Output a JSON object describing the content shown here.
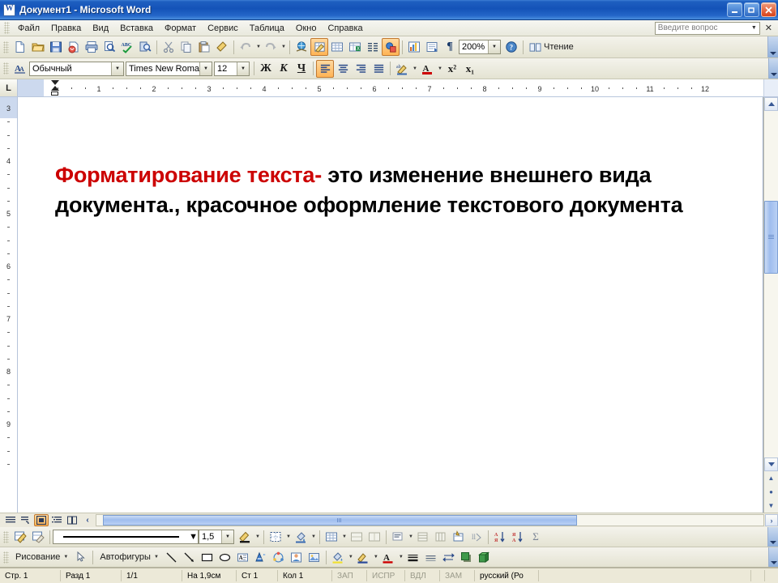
{
  "window": {
    "title": "Документ1 - Microsoft Word",
    "icon": "word-document-icon",
    "minimize": "_",
    "restore": "❐",
    "close": "✕",
    "titlebar_color": "#1453b8"
  },
  "menu": {
    "items": [
      {
        "label": "Файл"
      },
      {
        "label": "Правка"
      },
      {
        "label": "Вид"
      },
      {
        "label": "Вставка"
      },
      {
        "label": "Формат"
      },
      {
        "label": "Сервис"
      },
      {
        "label": "Таблица"
      },
      {
        "label": "Окно"
      },
      {
        "label": "Справка"
      }
    ],
    "ask_box": {
      "placeholder": "Введите вопрос",
      "value": "Введите вопрос"
    },
    "close_label": "✕"
  },
  "standard_toolbar": {
    "buttons": [
      {
        "name": "new-document-icon"
      },
      {
        "name": "open-folder-icon"
      },
      {
        "name": "save-icon"
      },
      {
        "name": "email-icon"
      },
      {
        "name": "print-icon"
      },
      {
        "name": "quick-print-icon"
      },
      {
        "name": "spelling-check-icon"
      },
      {
        "name": "research-icon"
      },
      {
        "name": "cut-scissors-icon"
      },
      {
        "name": "copy-icon"
      },
      {
        "name": "paste-icon"
      },
      {
        "name": "format-painter-icon"
      },
      {
        "name": "undo-icon"
      },
      {
        "name": "redo-icon"
      },
      {
        "name": "insert-hyperlink-icon"
      },
      {
        "name": "tables-and-borders-icon"
      },
      {
        "name": "insert-table-icon"
      },
      {
        "name": "insert-excel-sheet-icon"
      },
      {
        "name": "columns-icon"
      },
      {
        "name": "drawing-icon"
      },
      {
        "name": "document-map-icon"
      },
      {
        "name": "show-hide-paragraph-icon"
      },
      {
        "name": "pilcrow-icon"
      },
      {
        "name": "help-icon"
      }
    ],
    "zoom": {
      "value": "200%"
    },
    "reading_label": "Чтение",
    "pilcrow": "¶"
  },
  "formatting_toolbar": {
    "styles_icon": "styles-and-formatting-icon",
    "style": {
      "value": "Обычный"
    },
    "font": {
      "value": "Times New Roman"
    },
    "size": {
      "value": "12"
    },
    "bold": "Ж",
    "italic": "К",
    "underline": "Ч",
    "align_left": "align-left-icon",
    "align_center": "align-center-icon",
    "align_right": "align-right-icon",
    "align_justify": "align-justify-icon",
    "highlight": "highlight-icon",
    "font_color": "font-color-icon",
    "superscript": "x²",
    "subscript": "x₁"
  },
  "ruler": {
    "tab_selector": "L",
    "horizontal_ticks": [
      "1",
      "2",
      "3",
      "4",
      "5",
      "6",
      "7",
      "8",
      "9",
      "10",
      "11",
      "12"
    ],
    "vertical_ticks": [
      "3",
      "4",
      "5",
      "6",
      "7",
      "8",
      "9"
    ]
  },
  "document": {
    "red_text": "Форматирование текста-",
    "rest_text": " это изменение внешнего вида документа., красочное оформление текстового документа",
    "red_color": "#cc0000"
  },
  "view_bar": {
    "buttons": [
      {
        "name": "normal-view-icon"
      },
      {
        "name": "web-layout-view-icon"
      },
      {
        "name": "print-layout-view-icon",
        "selected": true
      },
      {
        "name": "outline-view-icon"
      },
      {
        "name": "reading-layout-view-icon"
      }
    ],
    "prev_label": "‹",
    "next_label": "›"
  },
  "drawing_toolbar_top": {
    "buttons": [
      {
        "name": "insert-wordart-icon"
      },
      {
        "name": "edit-shape-icon"
      },
      {
        "name": "dotted-border-icon"
      },
      {
        "name": "fill-color-icon"
      },
      {
        "name": "table-icon"
      },
      {
        "name": "merge-cells-icon"
      },
      {
        "name": "split-cells-icon"
      },
      {
        "name": "align-cell-icon"
      },
      {
        "name": "distribute-rows-icon"
      },
      {
        "name": "distribute-columns-icon"
      },
      {
        "name": "table-autoformat-icon"
      },
      {
        "name": "change-text-direction-icon"
      },
      {
        "name": "sort-ascending-icon"
      },
      {
        "name": "sort-descending-icon"
      },
      {
        "name": "autosum-icon"
      }
    ],
    "line_style": {
      "value": ""
    },
    "line_width": {
      "value": "1,5"
    },
    "sum_symbol": "Σ"
  },
  "drawing_toolbar_bottom": {
    "draw_label": "Рисование",
    "select_objects": "select-arrow-icon",
    "autoshapes_label": "Автофигуры",
    "buttons": [
      {
        "name": "line-icon"
      },
      {
        "name": "arrow-icon"
      },
      {
        "name": "rectangle-icon"
      },
      {
        "name": "oval-icon"
      },
      {
        "name": "text-box-icon"
      },
      {
        "name": "insert-wordart-icon"
      },
      {
        "name": "insert-diagram-icon"
      },
      {
        "name": "insert-clip-art-icon"
      },
      {
        "name": "insert-picture-icon"
      },
      {
        "name": "fill-color-icon"
      },
      {
        "name": "line-color-icon"
      },
      {
        "name": "font-color-icon"
      },
      {
        "name": "line-style-icon"
      },
      {
        "name": "dash-style-icon"
      },
      {
        "name": "arrow-style-icon"
      },
      {
        "name": "shadow-style-icon"
      },
      {
        "name": "3d-style-icon"
      }
    ]
  },
  "status_bar": {
    "page": "Стр. 1",
    "section": "Разд 1",
    "page_of": "1/1",
    "at": "На 1,9см",
    "line": "Ст 1",
    "column": "Кол 1",
    "rec": "ЗАП",
    "trk": "ИСПР",
    "ext": "ВДЛ",
    "ovr": "ЗАМ",
    "language": "русский (Ро"
  }
}
